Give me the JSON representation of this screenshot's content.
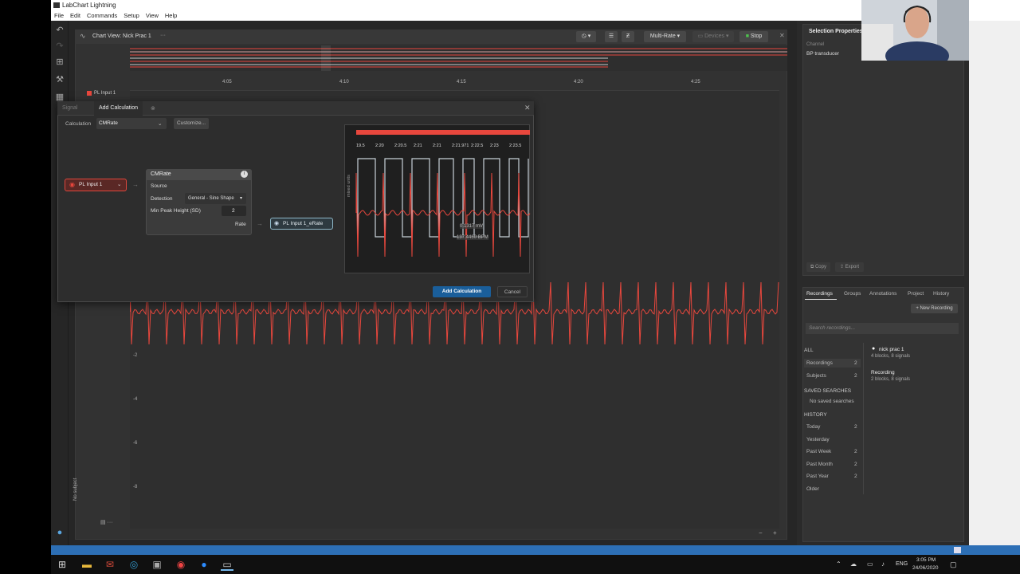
{
  "app": {
    "title": "LabChart Lightning",
    "menu": [
      "File",
      "Edit",
      "Commands",
      "Setup",
      "View",
      "Help"
    ]
  },
  "chart_view": {
    "title": "Chart View: Nick Prac 1",
    "more": "···",
    "multi_rate": "Multi-Rate",
    "devices": "Devices",
    "stop": "Stop",
    "times": [
      "4:05",
      "4:10",
      "4:15",
      "4:20",
      "4:25"
    ],
    "channel_label": "PL Input 1",
    "channel_top_value": "10",
    "y_ticks": [
      "-2",
      "-4",
      "-6",
      "-8"
    ],
    "no_subject": "No subject"
  },
  "dialog": {
    "tab_signal": "Signal",
    "tab_add": "Add Calculation",
    "calculation_label": "Calculation",
    "calculation_value": "CMRate",
    "customize": "Customize...",
    "source_channel": "PL Input 1",
    "card_title": "CMRate",
    "card_source": "Source",
    "detection_label": "Detection",
    "detection_value": "General - Sine Shape",
    "min_peak_label": "Min Peak Height (SD)",
    "min_peak_value": "2",
    "rate_label": "Rate",
    "output_channel": "PL Input 1_eRate",
    "preview_ticks": [
      "19.5",
      "2:20",
      "2:20.5",
      "2:21",
      "2:21",
      "2:21.971",
      "2:22.5",
      "2:23",
      "2:23.5"
    ],
    "preview_ylabel": "mixed units",
    "preview_readout1": "0.1317 mV",
    "preview_readout2": "137.4460 BPM",
    "add_button": "Add Calculation",
    "cancel_button": "Cancel"
  },
  "selection_properties": {
    "title": "Selection Properties",
    "channel_label": "Channel",
    "channel_value": "BP transducer",
    "copy": "Copy",
    "export": "Export"
  },
  "recordings_panel": {
    "tabs": [
      "Recordings",
      "Groups",
      "Annotations",
      "Project",
      "History"
    ],
    "new_recording": "+ New Recording",
    "search_placeholder": "Search recordings...",
    "all_header": "ALL",
    "recordings_label": "Recordings",
    "recordings_count": "2",
    "subjects_label": "Subjects",
    "subjects_count": "2",
    "saved_header": "SAVED SEARCHES",
    "no_saved": "No saved searches",
    "history_header": "HISTORY",
    "history": [
      {
        "label": "Today",
        "count": "2"
      },
      {
        "label": "Yesterday",
        "count": ""
      },
      {
        "label": "Past Week",
        "count": "2"
      },
      {
        "label": "Past Month",
        "count": "2"
      },
      {
        "label": "Past Year",
        "count": "2"
      },
      {
        "label": "Older",
        "count": ""
      }
    ],
    "items": [
      {
        "name": "nick prac 1",
        "meta": "4 blocks, 8 signals"
      },
      {
        "name": "Recording",
        "meta": "2 blocks, 8 signals"
      }
    ]
  },
  "taskbar": {
    "lang": "ENG",
    "time": "3:05 PM",
    "date": "24/06/2020"
  },
  "colors": {
    "signal": "#e8473d",
    "accent_blue": "#1a5e9a",
    "status_blue": "#2d6fb5"
  }
}
